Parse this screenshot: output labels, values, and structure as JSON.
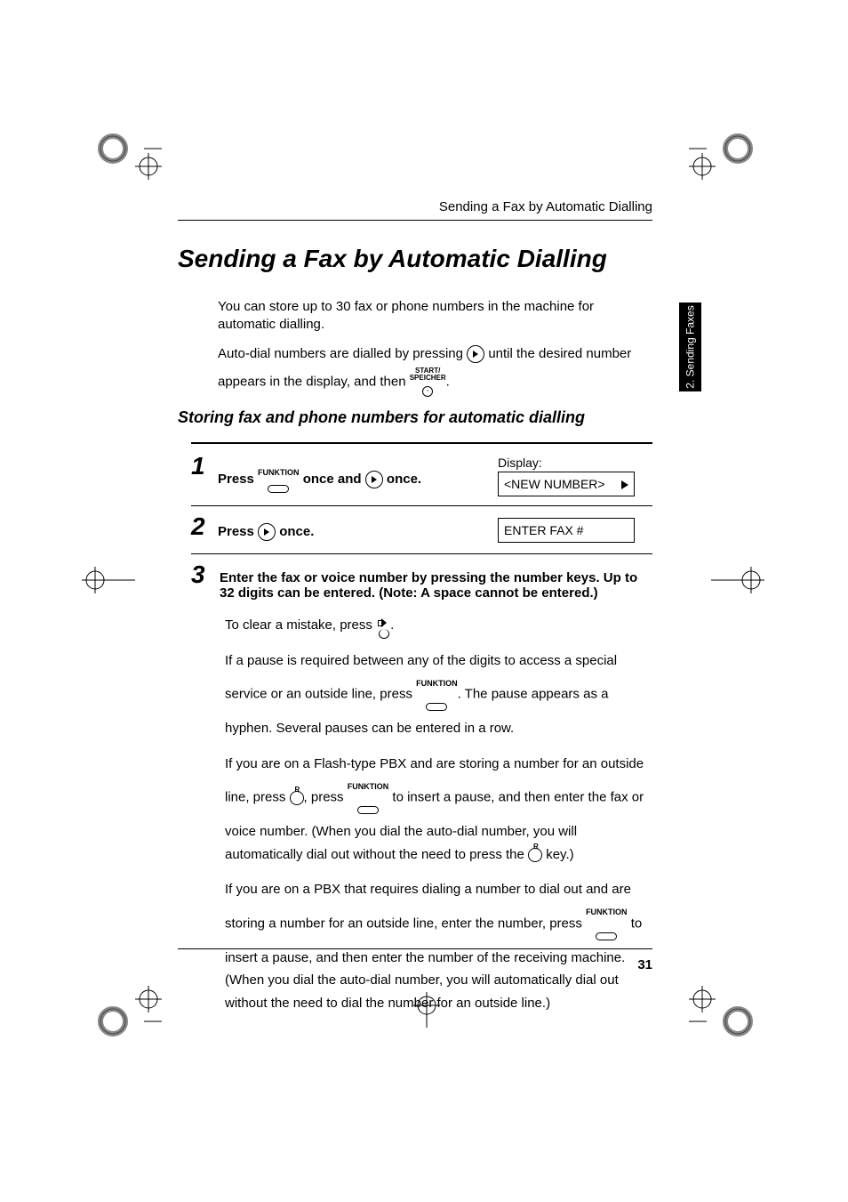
{
  "runningHead": "Sending a Fax by Automatic Dialling",
  "title": "Sending a Fax by Automatic Dialling",
  "intro1": "You can store up to 30 fax or phone numbers in the machine for automatic dialling.",
  "intro2a": "Auto-dial numbers are dialled by pressing ",
  "intro2b": " until the desired number appears in the display, and then ",
  "intro2c": ".",
  "subhead": "Storing fax and phone numbers for automatic dialling",
  "sidebar": "2. Sending Faxes",
  "step1": {
    "num": "1",
    "a": "Press ",
    "b": " once and ",
    "c": " once.",
    "displayLbl": "Display:",
    "displayVal": "<NEW NUMBER>"
  },
  "step2": {
    "num": "2",
    "a": "Press ",
    "b": " once.",
    "displayVal": "ENTER FAX #"
  },
  "step3": {
    "num": "3",
    "heading": "Enter the fax or voice number by pressing the number keys. Up to 32 digits can be entered. (Note: A space cannot be entered.)",
    "p1a": "To clear a mistake, press ",
    "p1b": ".",
    "p2a": "If a pause is required between any of the digits to access a special service or an outside line, press ",
    "p2b": ". The pause appears as a hyphen. Several pauses can be entered in a row.",
    "p3a": "If you are on a Flash-type PBX and are storing a number for an outside line, press ",
    "p3b": ", press ",
    "p3c": " to insert a pause, and then enter the fax or voice number. (When you dial the auto-dial number, you will automatically dial out without the need to press the ",
    "p3d": " key.)",
    "p4a": "If you are on a PBX that requires dialing a number to dial out and are storing a number for an outside line, enter the number, press ",
    "p4b": " to insert a pause, and then enter the number of the receiving machine. (When you dial the auto-dial number, you will automatically dial out without the need to dial the number for an outside line.)"
  },
  "keys": {
    "funktion": "FUNKTION",
    "startLine1": "START/",
    "startLine2": "SPEICHER",
    "r": "R"
  },
  "pageNum": "31"
}
